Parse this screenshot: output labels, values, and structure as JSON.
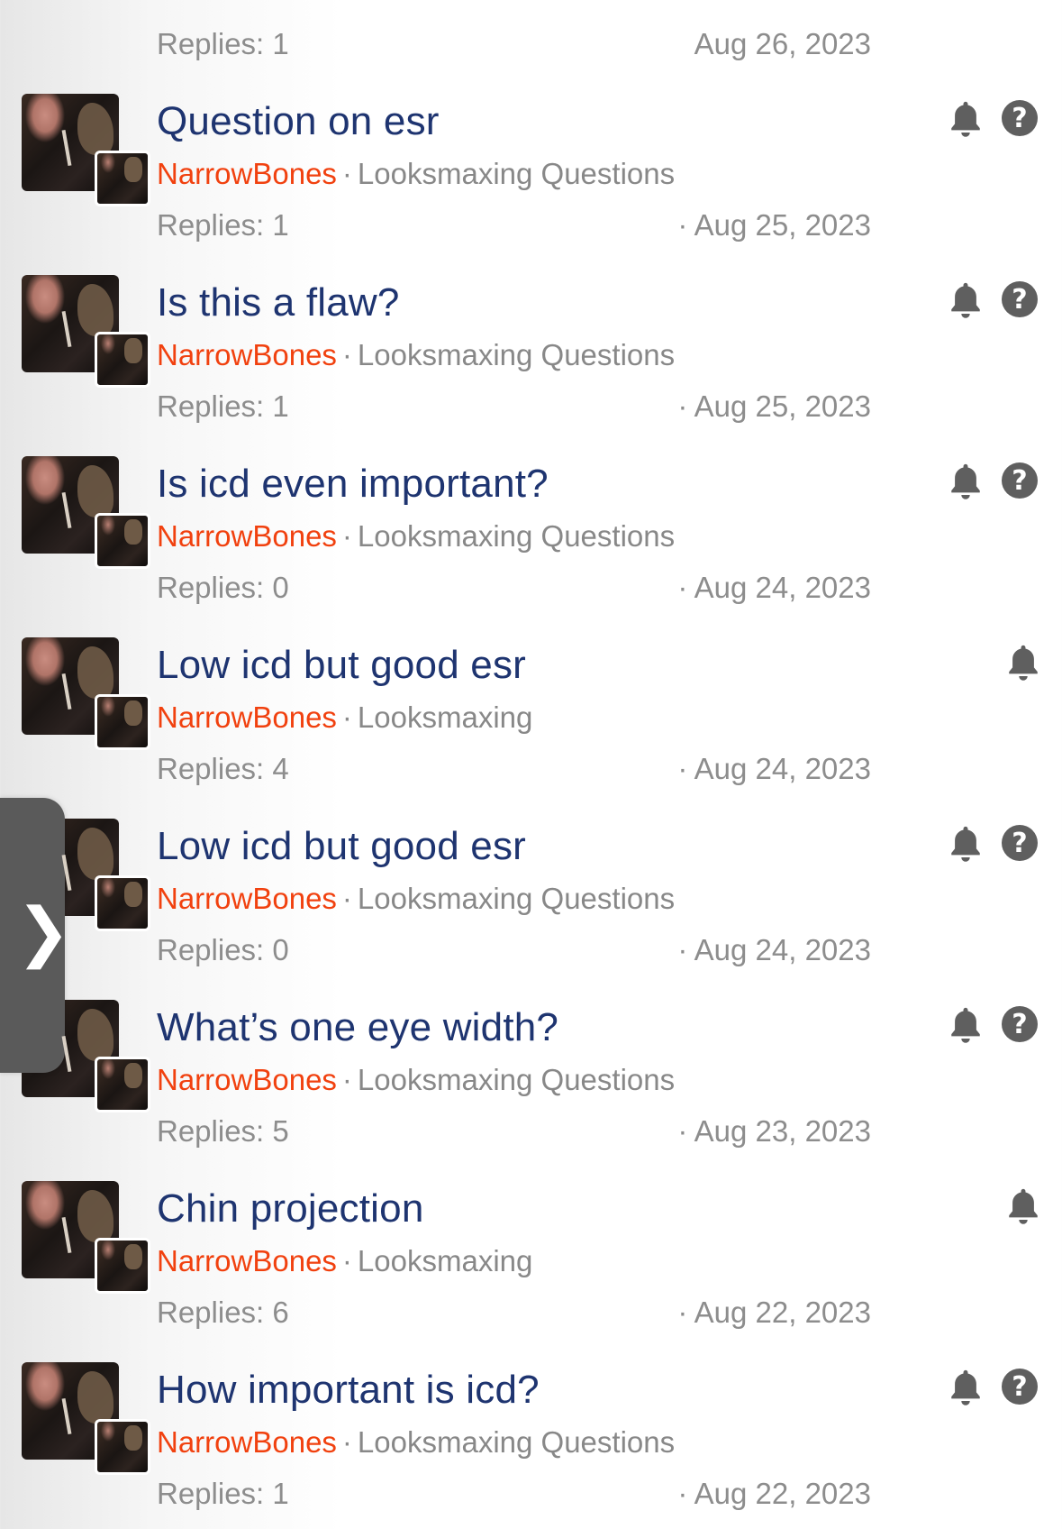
{
  "partial_top": {
    "replies": "Replies: 1",
    "date": "Aug 26, 2023"
  },
  "threads": [
    {
      "title": "Question on esr",
      "author": "NarrowBones",
      "separator": "·",
      "forum": "Looksmaxing Questions",
      "replies": "Replies: 1",
      "date": "· Aug 25, 2023",
      "icons": [
        "bell-icon",
        "question-icon"
      ]
    },
    {
      "title": "Is this a flaw?",
      "author": "NarrowBones",
      "separator": "·",
      "forum": "Looksmaxing Questions",
      "replies": "Replies: 1",
      "date": "· Aug 25, 2023",
      "icons": [
        "bell-icon",
        "question-icon"
      ]
    },
    {
      "title": "Is icd even important?",
      "author": "NarrowBones",
      "separator": "·",
      "forum": "Looksmaxing Questions",
      "replies": "Replies: 0",
      "date": "· Aug 24, 2023",
      "icons": [
        "bell-icon",
        "question-icon"
      ]
    },
    {
      "title": "Low icd but good esr",
      "author": "NarrowBones",
      "separator": "·",
      "forum": "Looksmaxing",
      "replies": "Replies: 4",
      "date": "· Aug 24, 2023",
      "icons": [
        "bell-icon"
      ]
    },
    {
      "title": "Low icd but good esr",
      "author": "NarrowBones",
      "separator": "·",
      "forum": "Looksmaxing Questions",
      "replies": "Replies: 0",
      "date": "· Aug 24, 2023",
      "icons": [
        "bell-icon",
        "question-icon"
      ]
    },
    {
      "title": "What’s one eye width?",
      "author": "NarrowBones",
      "separator": "·",
      "forum": "Looksmaxing Questions",
      "replies": "Replies: 5",
      "date": "· Aug 23, 2023",
      "icons": [
        "bell-icon",
        "question-icon"
      ]
    },
    {
      "title": "Chin projection",
      "author": "NarrowBones",
      "separator": "·",
      "forum": "Looksmaxing",
      "replies": "Replies: 6",
      "date": "· Aug 22, 2023",
      "icons": [
        "bell-icon"
      ]
    },
    {
      "title": "How important is icd?",
      "author": "NarrowBones",
      "separator": "·",
      "forum": "Looksmaxing Questions",
      "replies": "Replies: 1",
      "date": "· Aug 22, 2023",
      "icons": [
        "bell-icon",
        "question-icon"
      ]
    }
  ],
  "drawer": {
    "chevron": "❯",
    "icon": "chevron-right-icon"
  },
  "colors": {
    "title": "#1e3470",
    "author": "#f1410f",
    "meta": "#888888",
    "icon": "#5f5f5f"
  }
}
